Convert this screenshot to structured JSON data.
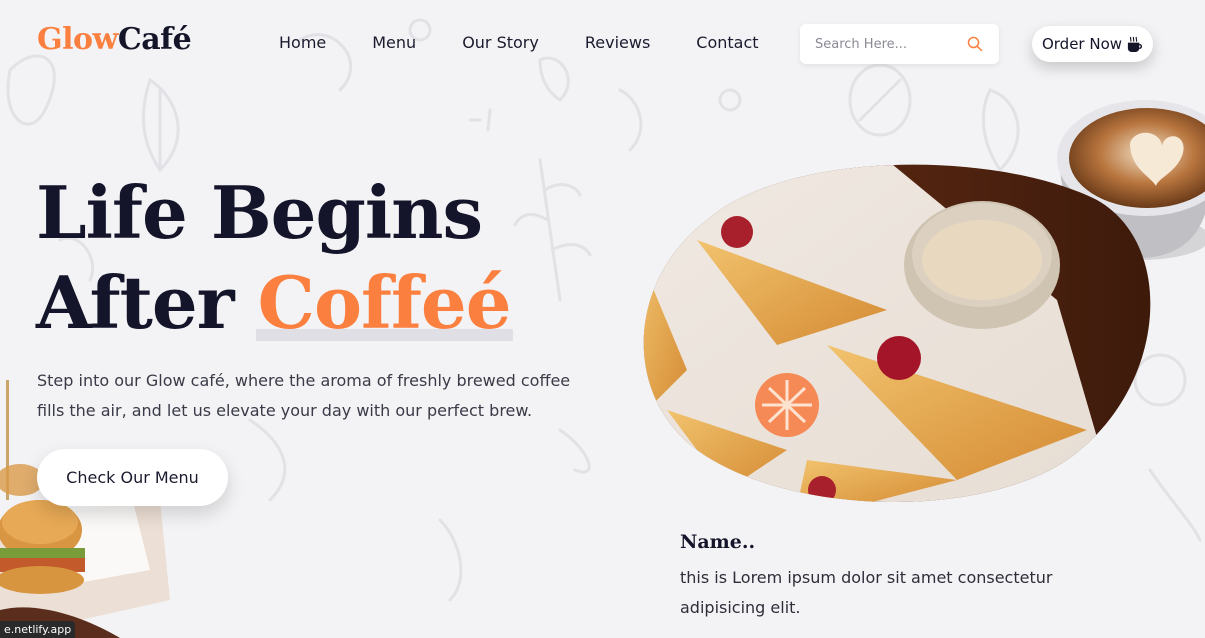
{
  "brand": {
    "part1": "Glow",
    "part2": "Café"
  },
  "nav": {
    "items": [
      {
        "label": "Home"
      },
      {
        "label": "Menu"
      },
      {
        "label": "Our Story"
      },
      {
        "label": "Reviews"
      },
      {
        "label": "Contact"
      }
    ]
  },
  "search": {
    "placeholder": "Search Here...",
    "value": "",
    "icon": "search-icon"
  },
  "order": {
    "label": "Order Now",
    "icon": "coffee-cup-icon"
  },
  "hero": {
    "line1": "Life Begins",
    "line2_prefix": "After",
    "line2_accent": "Coffeé",
    "description": "Step into our Glow café, where the aroma of freshly brewed coffee fills the air, and let us elevate your day with our perfect brew.",
    "cta": "Check Our Menu"
  },
  "featured": {
    "name": "Name..",
    "description": "this is Lorem ipsum dolor sit amet consectetur adipisicing elit."
  },
  "status_bar": {
    "url": "e.netlify.app"
  },
  "colors": {
    "accent": "#fb8040",
    "dark": "#14142a",
    "background": "#f3f3f5"
  }
}
